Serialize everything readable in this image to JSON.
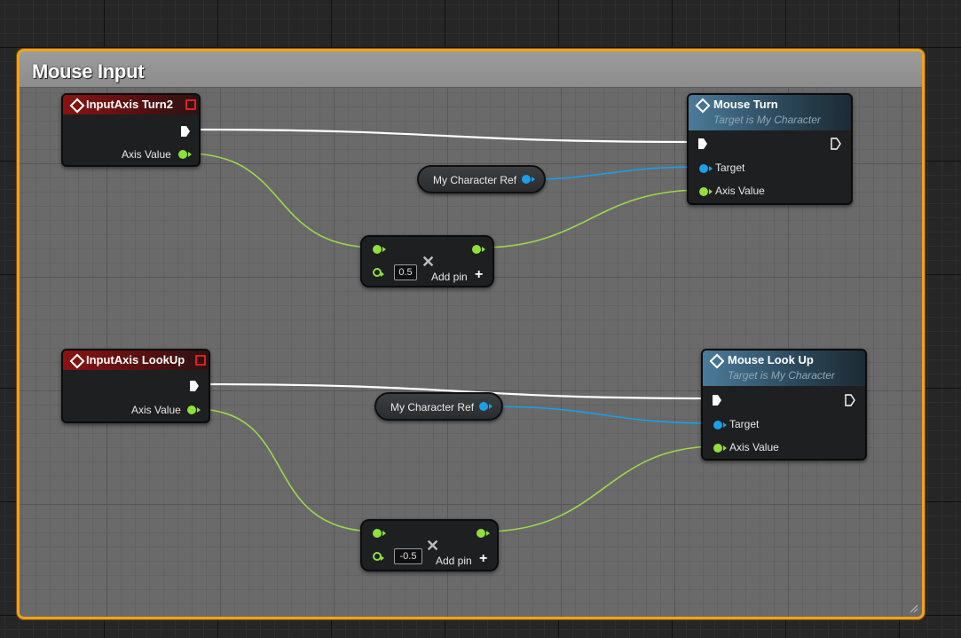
{
  "comment": {
    "title": "Mouse Input",
    "color": "#f0a21d"
  },
  "nodes": {
    "input_turn": {
      "title": "InputAxis Turn2",
      "axis_label": "Axis Value"
    },
    "mouse_turn": {
      "title": "Mouse Turn",
      "subtitle": "Target is My Character",
      "target_label": "Target",
      "axis_label": "Axis Value"
    },
    "char_ref_1": {
      "label": "My Character Ref"
    },
    "multiply_1": {
      "value": "0.5",
      "add_pin": "Add pin"
    },
    "input_lookup": {
      "title": "InputAxis LookUp",
      "axis_label": "Axis Value"
    },
    "mouse_lookup": {
      "title": "Mouse Look Up",
      "subtitle": "Target is My Character",
      "target_label": "Target",
      "axis_label": "Axis Value"
    },
    "char_ref_2": {
      "label": "My Character Ref"
    },
    "multiply_2": {
      "value": "-0.5",
      "add_pin": "Add pin"
    }
  },
  "colors": {
    "float_pin": "#8fe03a",
    "object_pin": "#1aa0e8",
    "exec_wire": "#ffffff",
    "event_header": "#8a1313",
    "function_header": "#4b7b9a"
  },
  "icons": [
    "event-diamond-icon",
    "function-icon",
    "delegate-pin-icon",
    "multiply-x-icon",
    "add-pin-plus-icon",
    "exec-pin-icon"
  ]
}
